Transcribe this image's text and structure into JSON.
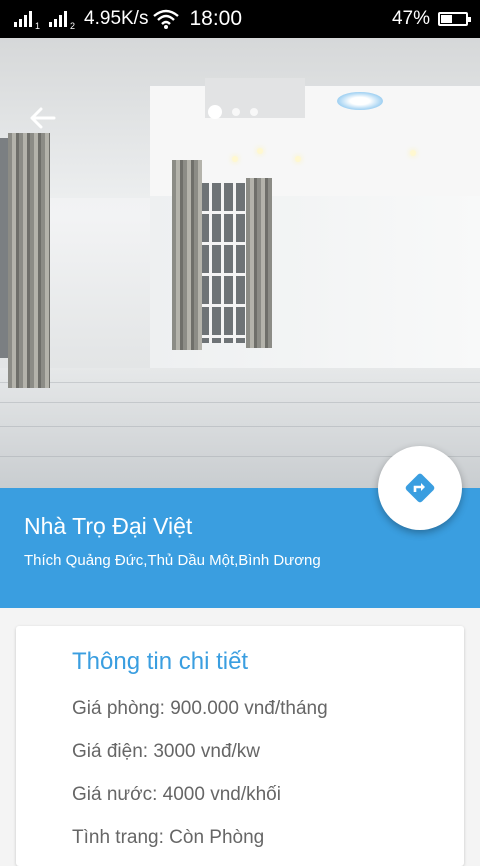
{
  "status_bar": {
    "net_speed": "4.95K/s",
    "time": "18:00",
    "battery": "47%",
    "battery_level": 0.47,
    "sim1": "1",
    "sim2": "2"
  },
  "hero": {
    "slide_count": 3,
    "active_slide": 1
  },
  "listing": {
    "title": "Nhà Trọ Đại Việt",
    "address": "Thích Quảng Đức,Thủ Dầu Một,Bình Dương"
  },
  "details": {
    "heading": "Thông tin chi tiết",
    "price": "Giá phòng: 900.000 vnđ/tháng",
    "electricity": "Giá điện: 3000 vnđ/kw",
    "water": "Giá nước: 4000 vnd/khối",
    "status": "Tình trang: Còn Phòng"
  },
  "colors": {
    "accent": "#3a9ee0",
    "detail_text": "#666666"
  },
  "icons": {
    "back": "arrow-left-icon",
    "directions": "directions-icon"
  }
}
